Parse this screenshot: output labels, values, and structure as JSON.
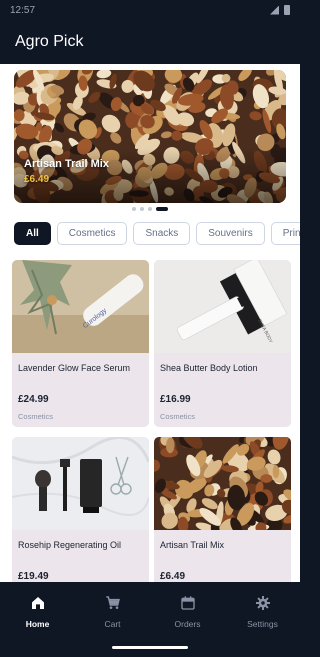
{
  "app": {
    "title": "Agro Pick"
  },
  "status_bar": {
    "time": "12:57"
  },
  "hero": {
    "name": "Artisan Trail Mix",
    "price": "£6.49"
  },
  "carousel": {
    "count": 4,
    "active_index": 3
  },
  "categories": [
    {
      "label": "All",
      "active": true
    },
    {
      "label": "Cosmetics",
      "active": false
    },
    {
      "label": "Snacks",
      "active": false
    },
    {
      "label": "Souvenirs",
      "active": false
    },
    {
      "label": "Print",
      "active": false
    }
  ],
  "products": [
    {
      "name": "Lavender Glow Face Serum",
      "price": "£24.99",
      "category": "Cosmetics",
      "brand_text": "Curology"
    },
    {
      "name": "Shea Butter Body Lotion",
      "price": "£16.99",
      "category": "Cosmetics",
      "brand_text": "SHEA BODY"
    },
    {
      "name": "Rosehip Regenerating Oil",
      "price": "£19.49",
      "category": ""
    },
    {
      "name": "Artisan Trail Mix",
      "price": "£6.49",
      "category": ""
    }
  ],
  "bottom_nav": [
    {
      "label": "Home",
      "icon": "home-icon",
      "active": true
    },
    {
      "label": "Cart",
      "icon": "cart-icon",
      "active": false
    },
    {
      "label": "Orders",
      "icon": "calendar-icon",
      "active": false
    },
    {
      "label": "Settings",
      "icon": "gear-icon",
      "active": false
    }
  ],
  "colors": {
    "dark": "#0f1624",
    "card": "#ece6ec",
    "price_accent": "#f5c23a",
    "chip_border": "#cfd6e1"
  }
}
